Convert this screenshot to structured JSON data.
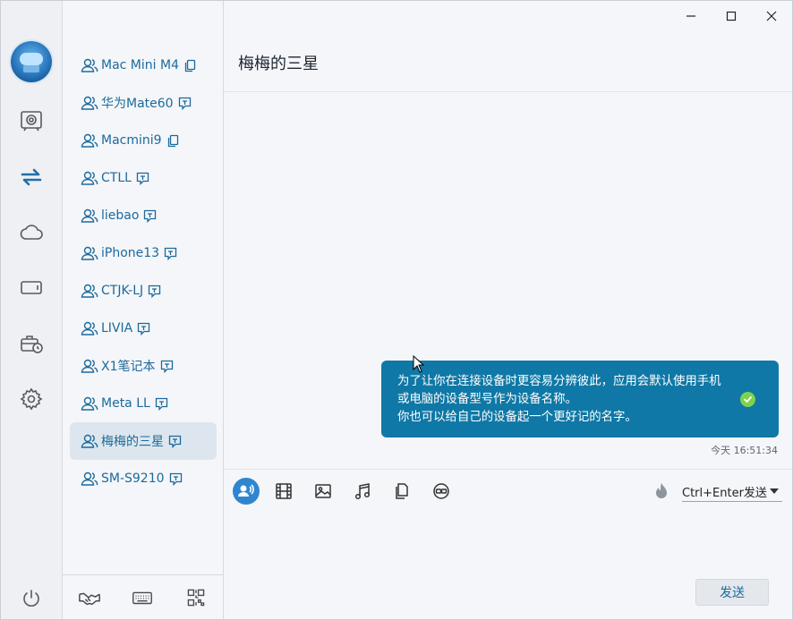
{
  "window": {
    "controls": {
      "minimize": "minimize-icon",
      "maximize": "maximize-icon",
      "close": "close-icon"
    }
  },
  "rail": {
    "items": [
      {
        "icon": "speaker-box-icon"
      },
      {
        "icon": "transfer-arrows-icon",
        "active": true
      },
      {
        "icon": "cloud-icon"
      },
      {
        "icon": "device-screen-icon"
      },
      {
        "icon": "briefcase-clock-icon"
      },
      {
        "icon": "gear-icon"
      },
      {
        "icon": "power-icon"
      }
    ]
  },
  "devices": {
    "items": [
      {
        "label": "Mac Mini M4",
        "badge": "copy-icon"
      },
      {
        "label": "华为Mate60",
        "badge": "chat-download-icon"
      },
      {
        "label": "Macmini9",
        "badge": "copy-icon"
      },
      {
        "label": "CTLL",
        "badge": "chat-download-icon"
      },
      {
        "label": "liebao",
        "badge": "chat-download-icon"
      },
      {
        "label": "iPhone13",
        "badge": "chat-download-icon"
      },
      {
        "label": "CTJK-LJ",
        "badge": "chat-download-icon"
      },
      {
        "label": "LIVIA",
        "badge": "chat-download-icon"
      },
      {
        "label": "X1笔记本",
        "badge": "chat-download-icon"
      },
      {
        "label": "Meta LL",
        "badge": "chat-download-icon"
      },
      {
        "label": "梅梅的三星",
        "badge": "chat-download-icon",
        "selected": true
      },
      {
        "label": "SM-S9210",
        "badge": "chat-download-icon"
      }
    ],
    "bottom": [
      "handshake-icon",
      "keyboard-icon",
      "qr-code-icon"
    ]
  },
  "chat": {
    "title": "梅梅的三星",
    "message": {
      "text": "为了让你在连接设备时更容易分辨彼此，应用会默认使用手机或电脑的设备型号作为设备名称。\n你也可以给自己的设备起一个更好记的名字。",
      "status": "check-icon",
      "timestamp": "今天 16:51:34"
    }
  },
  "toolbar": {
    "tools": [
      "contact-share-icon",
      "film-icon",
      "image-icon",
      "music-icon",
      "files-icon",
      "screen-share-icon"
    ],
    "burn_icon": "fire-icon",
    "send_mode": "Ctrl+Enter发送",
    "send_label": "发送"
  },
  "colors": {
    "accent": "#1b6a9c",
    "bubble": "#0f78a6",
    "active_tool": "#2f86cf",
    "check": "#7ed24d"
  }
}
